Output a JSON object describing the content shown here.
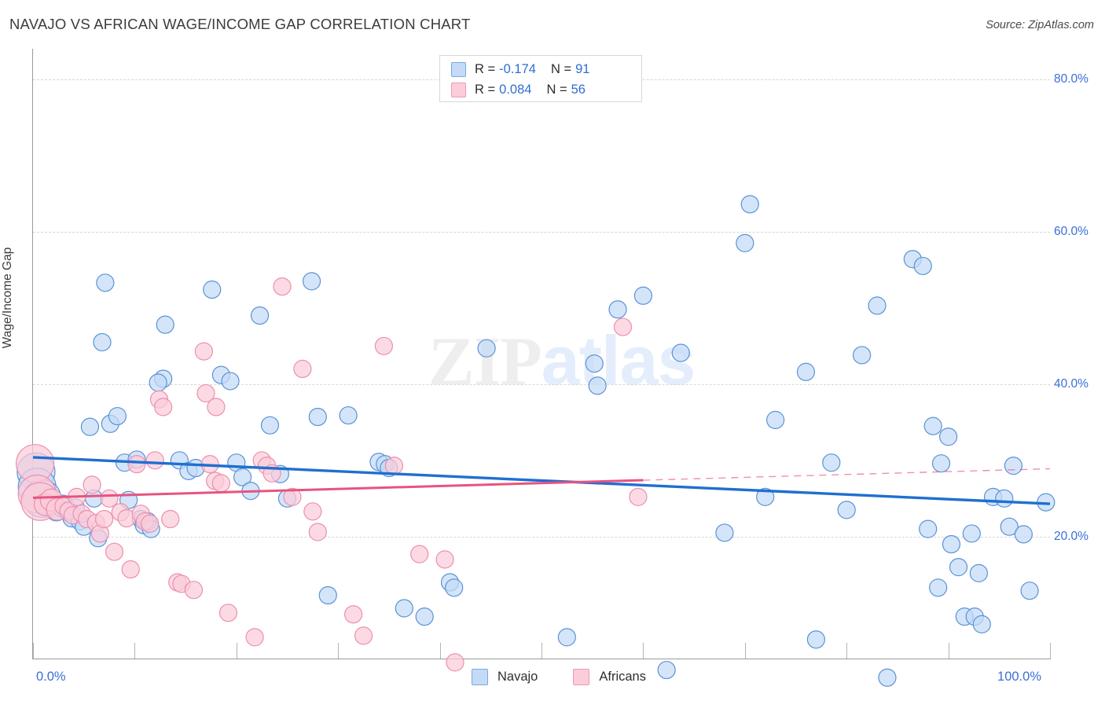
{
  "header": {
    "title": "NAVAJO VS AFRICAN WAGE/INCOME GAP CORRELATION CHART",
    "source": "Source: ZipAtlas.com"
  },
  "watermark": {
    "part1": "ZIP",
    "part2": "atlas"
  },
  "stats": {
    "navajo": {
      "r_label": "R =",
      "r_value": "-0.174",
      "n_label": "N =",
      "n_value": "91"
    },
    "africans": {
      "r_label": "R =",
      "r_value": "0.084",
      "n_label": "N =",
      "n_value": "56"
    }
  },
  "legend": {
    "navajo": "Navajo",
    "africans": "Africans"
  },
  "colors": {
    "navajo_fill": "#c3dbf7",
    "navajo_stroke": "#5b92d6",
    "africans_fill": "#fbccd9",
    "africans_stroke": "#ec8fad",
    "navajo_line": "#1f6fd0",
    "africans_line": "#e8537f",
    "axis_text": "#3a6fd8",
    "grid": "#d8d8d8"
  },
  "chart_data": {
    "type": "scatter",
    "title": "NAVAJO VS AFRICAN WAGE/INCOME GAP CORRELATION CHART",
    "xlabel": "",
    "ylabel": "Wage/Income Gap",
    "xlim": [
      0,
      100
    ],
    "ylim": [
      4.0,
      84.0
    ],
    "x_ticks": [
      "0.0%",
      "100.0%"
    ],
    "x_tick_values": [
      0,
      100
    ],
    "y_ticks": [
      "20.0%",
      "40.0%",
      "60.0%",
      "80.0%"
    ],
    "y_tick_values": [
      20,
      40,
      60,
      80
    ],
    "grid": true,
    "legend_position": "bottom-center",
    "series": [
      {
        "name": "Navajo",
        "color": "#c3dbf7",
        "r": -0.174,
        "n": 91,
        "trendline": {
          "x0": 0,
          "y0": 30.4,
          "x1": 100,
          "y1": 24.3,
          "style": "solid"
        },
        "points": [
          [
            0.3,
            28.5
          ],
          [
            0.4,
            26.5
          ],
          [
            0.9,
            25.0
          ],
          [
            1.6,
            24.2
          ],
          [
            2.3,
            23.5
          ],
          [
            2.9,
            24.0
          ],
          [
            3.4,
            23.2
          ],
          [
            3.8,
            22.4
          ],
          [
            4.2,
            23.8
          ],
          [
            4.6,
            22.0
          ],
          [
            5.0,
            21.3
          ],
          [
            5.6,
            34.4
          ],
          [
            6.0,
            25.0
          ],
          [
            6.4,
            19.8
          ],
          [
            7.1,
            53.3
          ],
          [
            6.8,
            45.5
          ],
          [
            7.6,
            34.8
          ],
          [
            8.3,
            35.8
          ],
          [
            9.0,
            29.7
          ],
          [
            9.4,
            24.8
          ],
          [
            10.2,
            30.1
          ],
          [
            10.6,
            22.3
          ],
          [
            10.9,
            21.5
          ],
          [
            11.3,
            22.0
          ],
          [
            11.6,
            21.0
          ],
          [
            12.8,
            40.7
          ],
          [
            12.3,
            40.2
          ],
          [
            13.0,
            47.8
          ],
          [
            14.4,
            30.0
          ],
          [
            15.3,
            28.6
          ],
          [
            16.0,
            29.0
          ],
          [
            17.6,
            52.4
          ],
          [
            18.5,
            41.2
          ],
          [
            19.4,
            40.4
          ],
          [
            20.0,
            29.7
          ],
          [
            20.6,
            27.8
          ],
          [
            21.4,
            26.0
          ],
          [
            22.3,
            49.0
          ],
          [
            23.3,
            34.6
          ],
          [
            24.3,
            28.2
          ],
          [
            25.0,
            25.0
          ],
          [
            27.4,
            53.5
          ],
          [
            28.0,
            35.7
          ],
          [
            29.0,
            12.3
          ],
          [
            31.0,
            35.9
          ],
          [
            34.0,
            29.8
          ],
          [
            34.6,
            29.5
          ],
          [
            35.0,
            29.0
          ],
          [
            36.5,
            10.6
          ],
          [
            38.5,
            9.5
          ],
          [
            41.0,
            14.0
          ],
          [
            41.4,
            13.3
          ],
          [
            44.6,
            44.7
          ],
          [
            52.5,
            6.8
          ],
          [
            55.5,
            39.8
          ],
          [
            55.2,
            42.7
          ],
          [
            57.5,
            49.8
          ],
          [
            60.0,
            51.6
          ],
          [
            62.3,
            2.5
          ],
          [
            63.7,
            44.1
          ],
          [
            68.0,
            20.5
          ],
          [
            70.5,
            63.6
          ],
          [
            70.0,
            58.5
          ],
          [
            73.0,
            35.3
          ],
          [
            72.0,
            25.2
          ],
          [
            76.0,
            41.6
          ],
          [
            77.0,
            6.5
          ],
          [
            78.5,
            29.7
          ],
          [
            80.0,
            23.5
          ],
          [
            81.5,
            43.8
          ],
          [
            83.0,
            50.3
          ],
          [
            84.0,
            1.5
          ],
          [
            86.5,
            56.4
          ],
          [
            87.5,
            55.5
          ],
          [
            88.5,
            34.5
          ],
          [
            88.0,
            21.0
          ],
          [
            89.0,
            13.3
          ],
          [
            89.3,
            29.6
          ],
          [
            90.0,
            33.1
          ],
          [
            90.3,
            19.0
          ],
          [
            91.0,
            16.0
          ],
          [
            91.6,
            9.5
          ],
          [
            92.3,
            20.4
          ],
          [
            92.6,
            9.5
          ],
          [
            93.3,
            8.5
          ],
          [
            93.0,
            15.2
          ],
          [
            94.4,
            25.2
          ],
          [
            95.5,
            25.0
          ],
          [
            96.4,
            29.3
          ],
          [
            96.0,
            21.3
          ],
          [
            97.4,
            20.3
          ],
          [
            98.0,
            12.9
          ],
          [
            99.6,
            24.5
          ]
        ]
      },
      {
        "name": "Africans",
        "color": "#fbccd9",
        "r": 0.084,
        "n": 56,
        "trendline": {
          "x0": 0,
          "y0": 25.1,
          "x1": 60.0,
          "y1": 27.4,
          "style": "solid"
        },
        "trendline_extension": {
          "x0": 60.0,
          "y0": 27.4,
          "x1": 100,
          "y1": 28.9,
          "style": "dashed"
        },
        "points": [
          [
            0.2,
            29.6
          ],
          [
            0.4,
            25.6
          ],
          [
            0.7,
            24.6
          ],
          [
            1.2,
            24.2
          ],
          [
            1.8,
            24.8
          ],
          [
            2.4,
            23.6
          ],
          [
            3.0,
            24.0
          ],
          [
            3.5,
            23.4
          ],
          [
            3.9,
            22.8
          ],
          [
            4.3,
            25.2
          ],
          [
            4.8,
            23.0
          ],
          [
            5.3,
            22.3
          ],
          [
            5.8,
            26.8
          ],
          [
            6.2,
            21.8
          ],
          [
            6.6,
            20.4
          ],
          [
            7.0,
            22.3
          ],
          [
            7.5,
            25.0
          ],
          [
            8.0,
            18.0
          ],
          [
            8.6,
            23.2
          ],
          [
            9.2,
            22.4
          ],
          [
            9.6,
            15.7
          ],
          [
            10.2,
            29.5
          ],
          [
            10.6,
            23.0
          ],
          [
            11.0,
            22.0
          ],
          [
            11.5,
            21.7
          ],
          [
            12.0,
            30.0
          ],
          [
            12.4,
            38.0
          ],
          [
            12.8,
            37.0
          ],
          [
            13.5,
            22.3
          ],
          [
            14.2,
            14.0
          ],
          [
            14.6,
            13.8
          ],
          [
            15.8,
            13.0
          ],
          [
            16.8,
            44.3
          ],
          [
            17.0,
            38.8
          ],
          [
            17.4,
            29.5
          ],
          [
            17.9,
            27.3
          ],
          [
            18.5,
            27.0
          ],
          [
            18.0,
            37.0
          ],
          [
            19.2,
            10.0
          ],
          [
            21.8,
            6.8
          ],
          [
            22.5,
            30.0
          ],
          [
            23.0,
            29.3
          ],
          [
            23.5,
            28.3
          ],
          [
            24.5,
            52.8
          ],
          [
            25.5,
            25.2
          ],
          [
            26.5,
            42.0
          ],
          [
            27.5,
            23.3
          ],
          [
            28.0,
            20.6
          ],
          [
            31.5,
            9.8
          ],
          [
            32.5,
            7.0
          ],
          [
            34.5,
            45.0
          ],
          [
            35.5,
            29.3
          ],
          [
            38.0,
            17.7
          ],
          [
            40.5,
            17.0
          ],
          [
            41.5,
            3.5
          ],
          [
            58.0,
            47.5
          ],
          [
            59.5,
            25.2
          ]
        ]
      }
    ]
  }
}
